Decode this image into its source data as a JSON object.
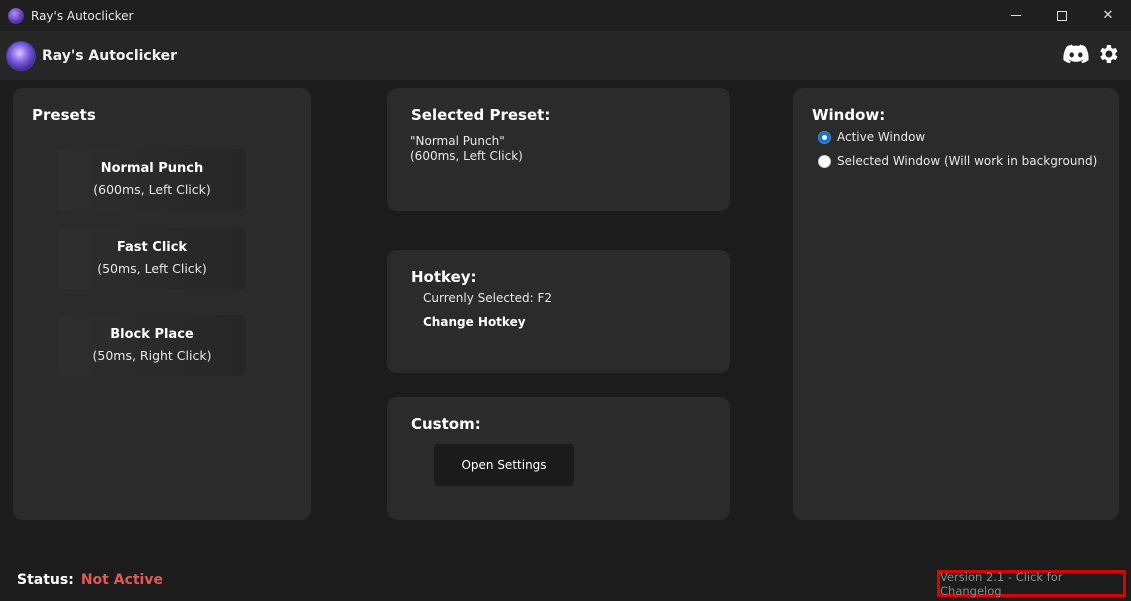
{
  "window": {
    "title": "Ray's Autoclicker",
    "controls": {
      "minimize": "",
      "maximize": "",
      "close": "✕"
    }
  },
  "header": {
    "app_name": "Ray's Autoclicker",
    "icons": [
      "discord-icon",
      "gear-icon"
    ]
  },
  "presets": {
    "title": "Presets",
    "items": [
      {
        "name": "Normal Punch",
        "desc": "(600ms, Left Click)"
      },
      {
        "name": "Fast Click",
        "desc": "(50ms, Left Click)"
      },
      {
        "name": "Block Place",
        "desc": "(50ms, Right Click)"
      }
    ]
  },
  "selected_preset": {
    "title": "Selected Preset:",
    "line1": "\"Normal Punch\"",
    "line2": "(600ms, Left Click)"
  },
  "hotkey": {
    "title": "Hotkey:",
    "current": "Currenly Selected: F2",
    "change_label": "Change Hotkey"
  },
  "custom": {
    "title": "Custom:",
    "open_settings_label": "Open Settings"
  },
  "window_target": {
    "title": "Window:",
    "options": [
      {
        "label": "Active Window",
        "selected": true
      },
      {
        "label": "Selected Window (Will work in background)",
        "selected": false
      }
    ]
  },
  "status": {
    "label": "Status:",
    "value": "Not Active",
    "value_color": "#e05a5a"
  },
  "version": {
    "label": "Version 2.1 - Click for Changelog"
  },
  "colors": {
    "accent_radio": "#1d6fc9",
    "highlight_box": "#e10000"
  }
}
